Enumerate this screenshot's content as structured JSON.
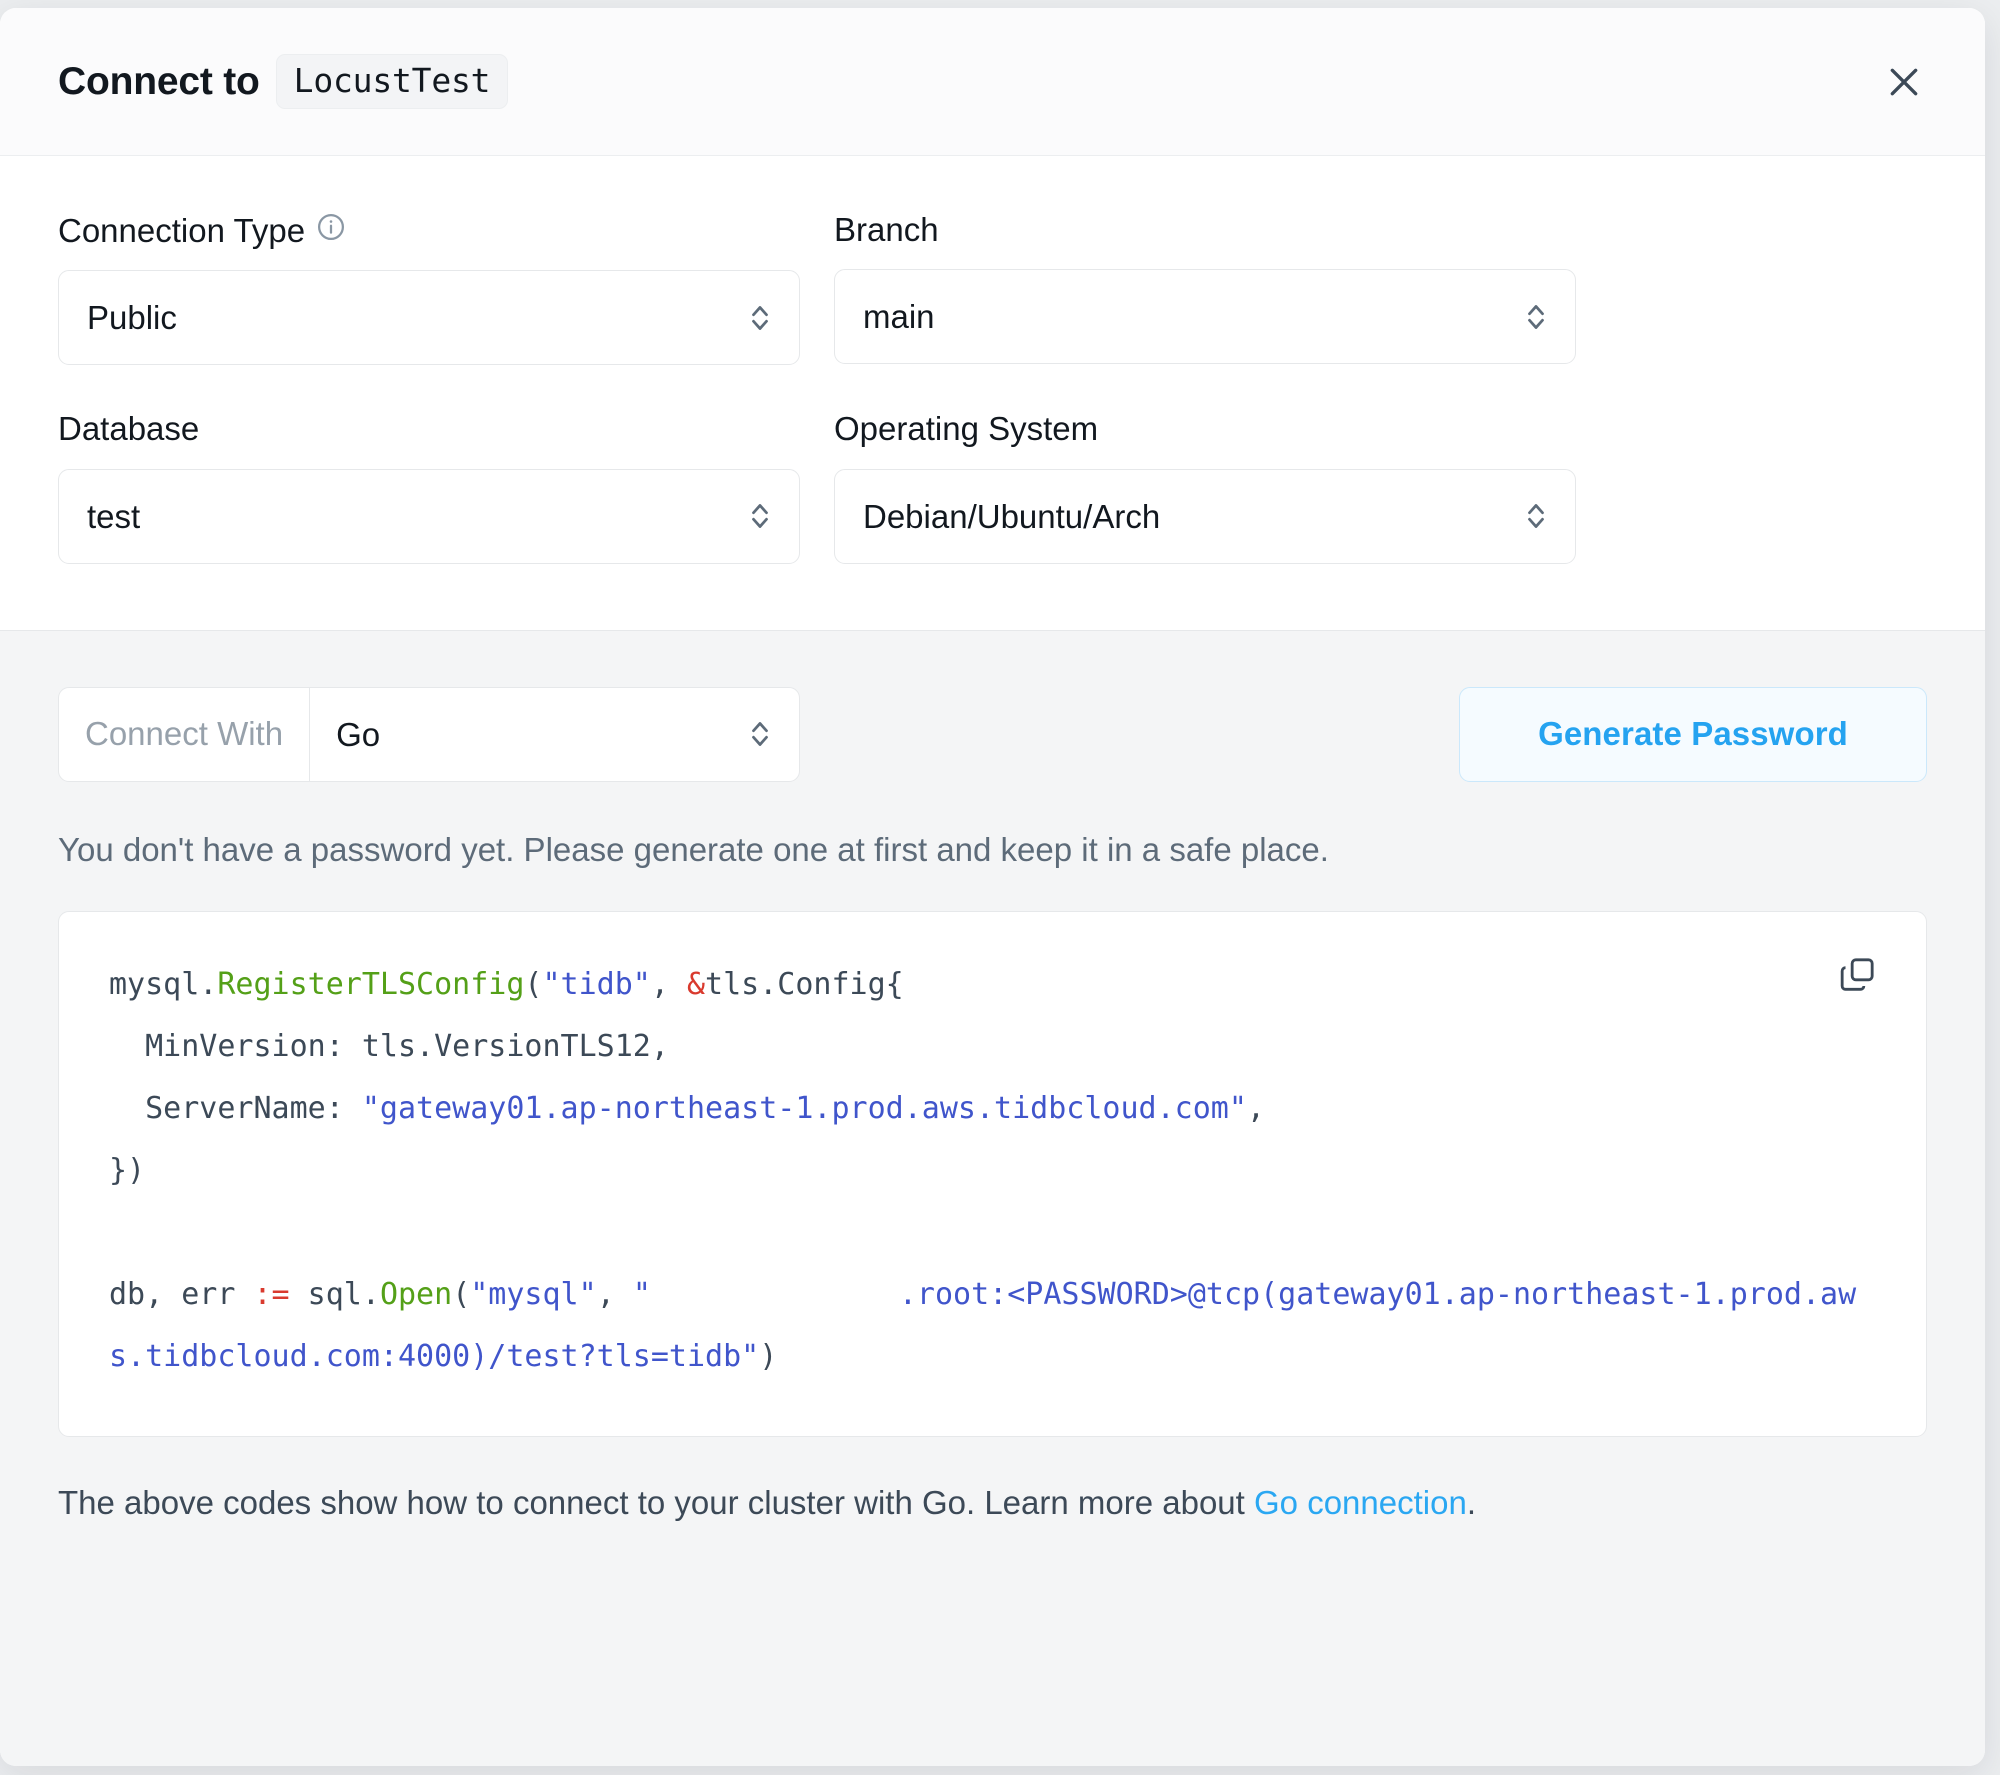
{
  "dialog": {
    "title_prefix": "Connect to",
    "cluster_name": "LocustTest",
    "close_label": "×"
  },
  "form": {
    "fields": [
      {
        "label": "Connection Type",
        "value": "Public",
        "has_info": true
      },
      {
        "label": "Branch",
        "value": "main",
        "has_info": false
      },
      {
        "label": "Database",
        "value": "test",
        "has_info": false
      },
      {
        "label": "Operating System",
        "value": "Debian/Ubuntu/Arch",
        "has_info": false
      }
    ]
  },
  "connect": {
    "addon_label": "Connect With",
    "language": "Go",
    "generate_password_label": "Generate Password",
    "notice": "You don't have a password yet. Please generate one at first and keep it in a safe place."
  },
  "code": {
    "line1_a": "mysql.",
    "line1_fn": "RegisterTLSConfig",
    "line1_b": "(",
    "line1_str": "\"tidb\"",
    "line1_c": ", ",
    "line1_amp": "&",
    "line1_d": "tls.Config{",
    "line2": "  MinVersion: tls.VersionTLS12,",
    "line3_a": "  ServerName: ",
    "line3_str": "\"gateway01.ap-northeast-1.prod.aws.tidbcloud.com\"",
    "line3_b": ",",
    "line4": "})",
    "line6_a": "db, err ",
    "line6_op": ":=",
    "line6_b": " sql.",
    "line6_fn": "Open",
    "line6_c": "(",
    "line6_str1": "\"mysql\"",
    "line6_d": ", ",
    "line6_quote": "\"",
    "line6_redacted": "",
    "line6_str2": ".root:<PASSWORD>@tcp(gateway01.ap-northeast-1.prod.aws.tidbcloud.com:4000)/test?tls=tidb\"",
    "line6_e": ")"
  },
  "footer": {
    "text_before": "The above codes show how to connect to your cluster with Go. Learn more about ",
    "link_text": "Go connection",
    "text_after": "."
  },
  "colors": {
    "accent_blue": "#25a3f0",
    "link_blue": "#2aa7f2",
    "code_string": "#4055cb",
    "code_function": "#54a018",
    "code_operator": "#d93a2e",
    "panel_gray": "#f4f5f6"
  }
}
